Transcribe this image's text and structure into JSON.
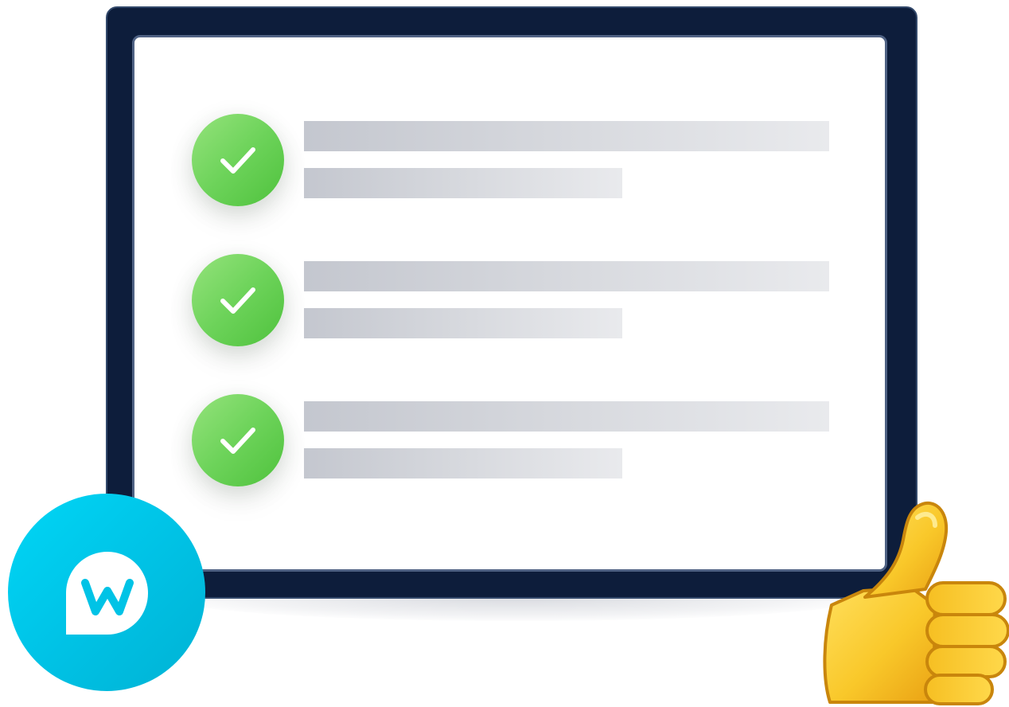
{
  "scene": {
    "icons": {
      "check": "check-circle-icon",
      "brand": "w-logo-icon",
      "reaction": "thumbs-up-icon"
    },
    "checklist": {
      "item_count": 3,
      "status": "complete"
    },
    "colors": {
      "monitor_frame": "#0d1d3b",
      "monitor_border": "#33496b",
      "screen": "#ffffff",
      "check_green": "#6dd35a",
      "placeholder_bar": "#d7d9de",
      "brand_cyan": "#00c3e6",
      "thumb_yellow": "#f8c528"
    }
  }
}
